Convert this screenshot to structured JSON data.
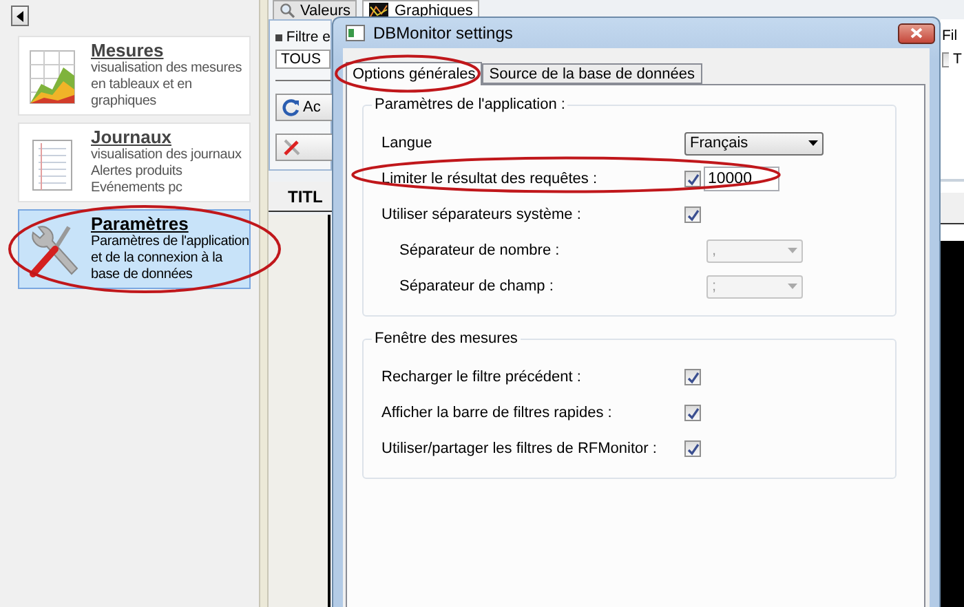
{
  "sidebar": {
    "items": [
      {
        "title": "Mesures",
        "lines": [
          "visualisation des mesures",
          "en tableaux et en",
          "graphiques"
        ],
        "kind": "chart",
        "selected": false,
        "circled": false
      },
      {
        "title": "Journaux",
        "lines": [
          "visualisation des journaux",
          "Alertes produits",
          "Evénements pc"
        ],
        "kind": "document",
        "selected": false,
        "circled": false
      },
      {
        "title": "Paramètres",
        "lines": [
          "Paramètres de l'application",
          "et de la connexion à la",
          "base de données"
        ],
        "kind": "tools",
        "selected": true,
        "circled": true
      }
    ]
  },
  "main": {
    "tabs": [
      {
        "label": "Valeurs",
        "kind": "search",
        "selected": false
      },
      {
        "label": "Graphiques",
        "kind": "chart",
        "selected": true
      }
    ],
    "filter": {
      "label": "Filtre e",
      "value": "TOUS"
    },
    "buttons": [
      {
        "label": "Ac",
        "kind": "refresh"
      },
      {
        "kind": "tool"
      }
    ],
    "column_header": "TITL",
    "right_filter": {
      "label": "Fil",
      "checkbox_label": "T",
      "checked": false
    }
  },
  "dialog": {
    "title": "DBMonitor settings",
    "tabs": [
      {
        "label": "Options générales",
        "selected": true,
        "circled": true
      },
      {
        "label": "Source de la base de données",
        "selected": false,
        "circled": false
      }
    ],
    "groups": [
      {
        "title": "Paramètres de l'application :",
        "rows": [
          {
            "kind": "combo",
            "label": "Langue",
            "value": "Français",
            "disabled": false
          },
          {
            "kind": "checkbox_input",
            "label": "Limiter le résultat des requêtes :",
            "checked": true,
            "value": "10000",
            "circled": true
          },
          {
            "kind": "checkbox",
            "label": "Utiliser séparateurs système :",
            "checked": true,
            "children": [
              {
                "kind": "combo",
                "label": "Séparateur de nombre :",
                "value": ",",
                "disabled": true
              },
              {
                "kind": "combo",
                "label": "Séparateur de champ :",
                "value": ";",
                "disabled": true
              }
            ]
          }
        ]
      },
      {
        "title": "Fenêtre des mesures",
        "rows": [
          {
            "kind": "checkbox",
            "label": "Recharger le filtre précédent :",
            "checked": true
          },
          {
            "kind": "checkbox",
            "label": "Afficher la barre de filtres rapides :",
            "checked": true
          },
          {
            "kind": "checkbox",
            "label": "Utiliser/partager les filtres de RFMonitor :",
            "checked": true
          }
        ]
      }
    ]
  }
}
